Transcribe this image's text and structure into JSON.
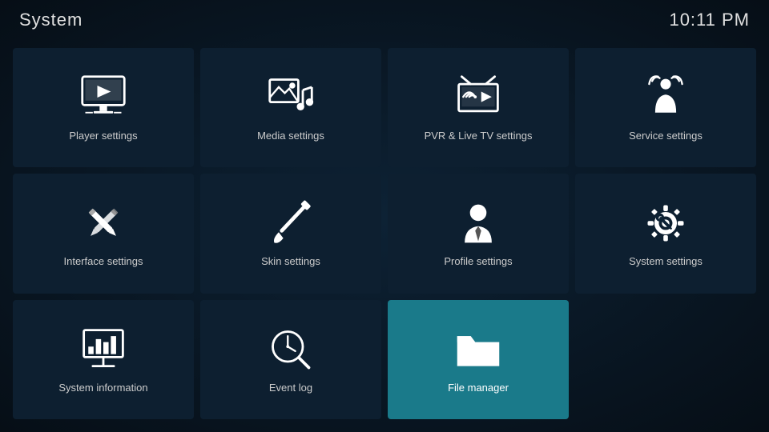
{
  "header": {
    "title": "System",
    "clock": "10:11 PM"
  },
  "tiles": [
    {
      "id": "player-settings",
      "label": "Player settings",
      "icon": "player",
      "active": false
    },
    {
      "id": "media-settings",
      "label": "Media settings",
      "icon": "media",
      "active": false
    },
    {
      "id": "pvr-settings",
      "label": "PVR & Live TV settings",
      "icon": "pvr",
      "active": false
    },
    {
      "id": "service-settings",
      "label": "Service settings",
      "icon": "service",
      "active": false
    },
    {
      "id": "interface-settings",
      "label": "Interface settings",
      "icon": "interface",
      "active": false
    },
    {
      "id": "skin-settings",
      "label": "Skin settings",
      "icon": "skin",
      "active": false
    },
    {
      "id": "profile-settings",
      "label": "Profile settings",
      "icon": "profile",
      "active": false
    },
    {
      "id": "system-settings",
      "label": "System settings",
      "icon": "system",
      "active": false
    },
    {
      "id": "system-information",
      "label": "System information",
      "icon": "sysinfo",
      "active": false
    },
    {
      "id": "event-log",
      "label": "Event log",
      "icon": "eventlog",
      "active": false
    },
    {
      "id": "file-manager",
      "label": "File manager",
      "icon": "filemanager",
      "active": true
    }
  ]
}
